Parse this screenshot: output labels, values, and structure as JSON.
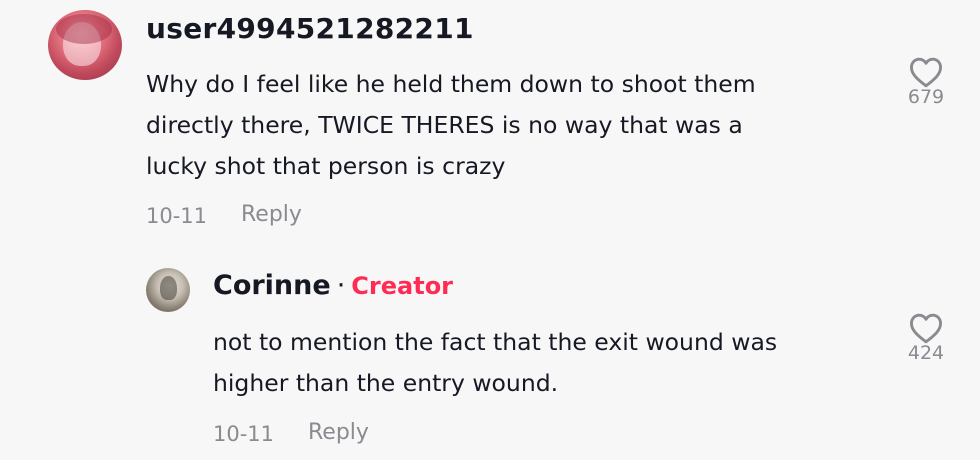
{
  "comment": {
    "username": "user4994521282211",
    "text_lines": [
      "Why do I feel like he held them down to shoot them",
      "directly there, TWICE THERES is no way that was a",
      "lucky shot that person is crazy"
    ],
    "date": "10-11",
    "reply_label": "Reply",
    "like_icon": "heart-outline-icon",
    "like_count": "679"
  },
  "reply": {
    "username": "Corinne",
    "separator": "·",
    "badge": "Creator",
    "badge_color": "#fe2c55",
    "text_lines": [
      "not to mention the fact that the exit wound was",
      "higher than the entry wound."
    ],
    "date": "10-11",
    "reply_label": "Reply",
    "like_icon": "heart-outline-icon",
    "like_count": "424"
  }
}
